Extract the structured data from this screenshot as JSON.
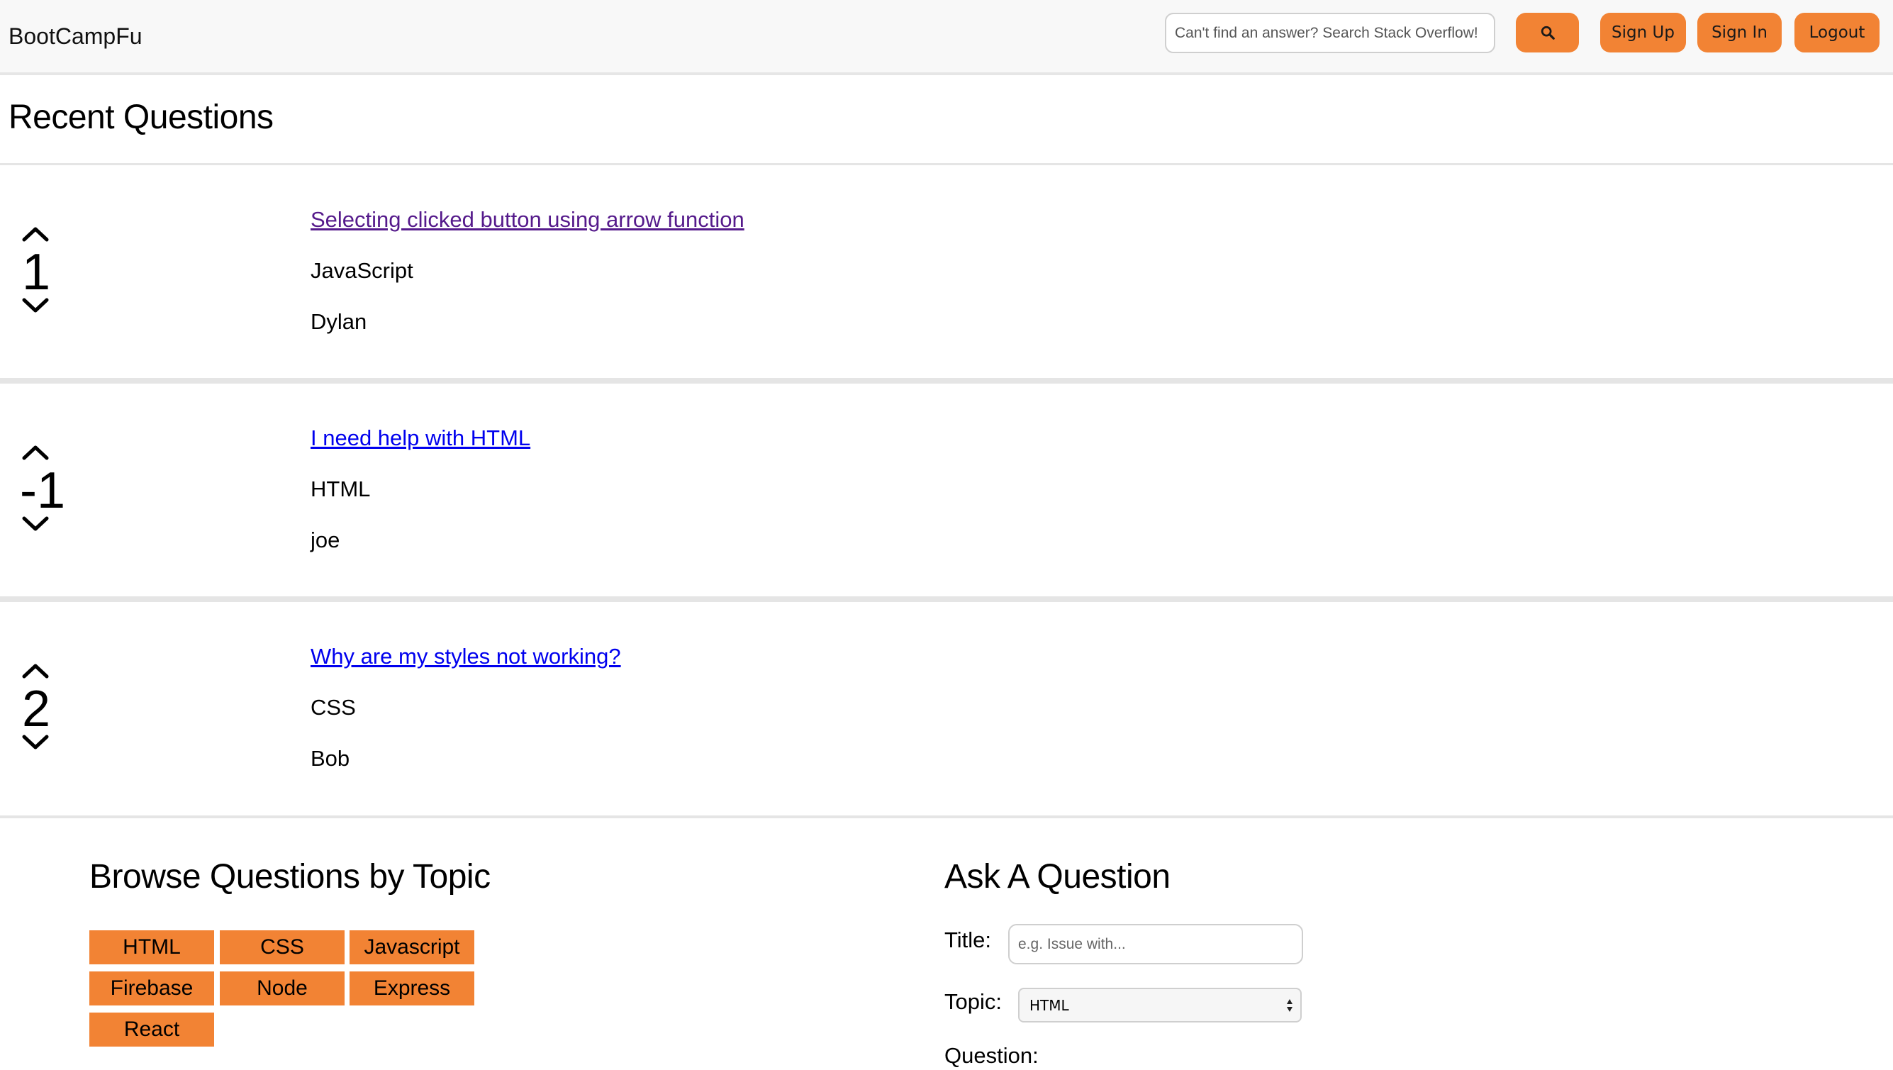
{
  "navbar": {
    "brand": "BootCampFu",
    "search_placeholder": "Can't find an answer? Search Stack Overflow!",
    "search_icon": "search-icon",
    "sign_up_label": "Sign Up",
    "sign_in_label": "Sign In",
    "logout_label": "Logout"
  },
  "recent": {
    "heading": "Recent Questions",
    "questions": [
      {
        "score": "1",
        "title": "Selecting clicked button using arrow function",
        "topic": "JavaScript",
        "author": "Dylan",
        "visited": true
      },
      {
        "score": "-1",
        "title": "I need help with HTML",
        "topic": "HTML",
        "author": "joe",
        "visited": false
      },
      {
        "score": "2",
        "title": "Why are my styles not working?",
        "topic": "CSS",
        "author": "Bob",
        "visited": false
      }
    ]
  },
  "browse": {
    "heading": "Browse Questions by Topic",
    "topics": [
      "HTML",
      "CSS",
      "Javascript",
      "Firebase",
      "Node",
      "Express",
      "React"
    ]
  },
  "ask": {
    "heading": "Ask A Question",
    "title_label": "Title:",
    "title_placeholder": "e.g. Issue with...",
    "topic_label": "Topic:",
    "topic_selected": "HTML",
    "question_label": "Question:"
  },
  "colors": {
    "accent": "#f28334",
    "link": "#0000ee",
    "link_visited": "#551a8b",
    "navbar_bg": "#f8f8f8"
  }
}
